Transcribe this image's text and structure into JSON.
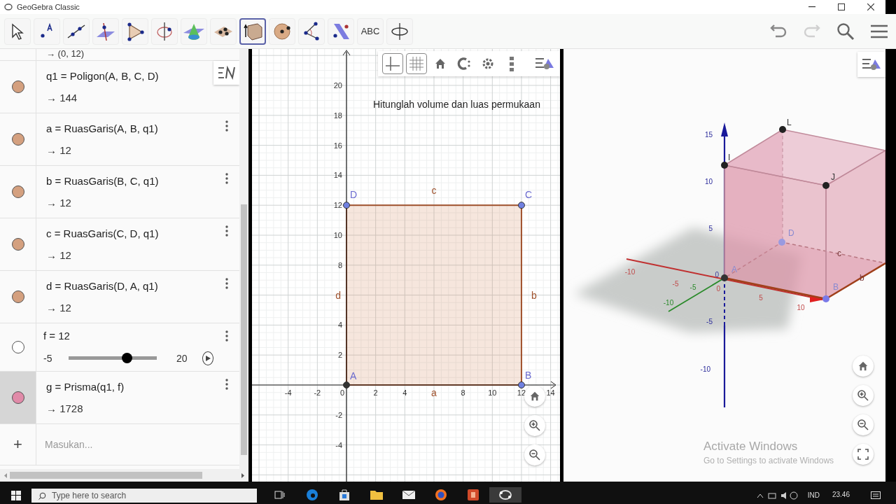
{
  "window": {
    "title": "GeoGebra Classic"
  },
  "toolbar": {
    "tools": [
      {
        "kind": "move",
        "selected": false
      },
      {
        "kind": "point",
        "selected": false
      },
      {
        "kind": "line",
        "selected": false
      },
      {
        "kind": "perpendicular",
        "selected": false
      },
      {
        "kind": "polygon",
        "selected": false
      },
      {
        "kind": "rotate-line",
        "selected": false
      },
      {
        "kind": "cone",
        "selected": false
      },
      {
        "kind": "plane",
        "selected": false
      },
      {
        "kind": "prism",
        "selected": true
      },
      {
        "kind": "sphere",
        "selected": false
      },
      {
        "kind": "angle",
        "selected": false
      },
      {
        "kind": "reflect",
        "selected": false
      },
      {
        "kind": "text",
        "label": "ABC",
        "selected": false
      },
      {
        "kind": "rotate-view",
        "selected": false
      }
    ],
    "actions": [
      {
        "kind": "undo",
        "disabled": false
      },
      {
        "kind": "redo",
        "disabled": true
      },
      {
        "kind": "search"
      },
      {
        "kind": "menu"
      }
    ]
  },
  "algebra": {
    "rows": [
      {
        "kind": "partial",
        "value": "→ (0, 12)"
      },
      {
        "kind": "expression",
        "definition": "q1 = Poligon(A, B, C, D)",
        "value": "→ 144",
        "color": "#d4a07f",
        "menu": false,
        "selected": false
      },
      {
        "kind": "expression",
        "definition": "a = RuasGaris(A, B, q1)",
        "value": "→ 12",
        "color": "#d4a07f",
        "menu": true,
        "selected": false
      },
      {
        "kind": "expression",
        "definition": "b = RuasGaris(B, C, q1)",
        "value": "→ 12",
        "color": "#d4a07f",
        "menu": true,
        "selected": false
      },
      {
        "kind": "expression",
        "definition": "c = RuasGaris(C, D, q1)",
        "value": "→ 12",
        "color": "#d4a07f",
        "menu": true,
        "selected": false
      },
      {
        "kind": "expression",
        "definition": "d = RuasGaris(D, A, q1)",
        "value": "→ 12",
        "color": "#d4a07f",
        "menu": true,
        "selected": false
      },
      {
        "kind": "slider",
        "definition": "f = 12",
        "min": "-5",
        "max": "20",
        "level": 0.66,
        "color": "#ffffff",
        "menu": true,
        "selected": false
      },
      {
        "kind": "expression",
        "definition": "g = Prisma(q1, f)",
        "value": "→ 1728",
        "color": "#e08aa8",
        "menu": true,
        "selected": true
      }
    ],
    "input": {
      "icon": "+",
      "placeholder": "Masukan..."
    }
  },
  "graphics2d": {
    "text": "Hitunglah volume dan luas permukaan",
    "style_bar": [
      {
        "kind": "axes",
        "selected": true
      },
      {
        "kind": "grid",
        "selected": true
      },
      {
        "kind": "home",
        "selected": false
      },
      {
        "kind": "label",
        "selected": false
      },
      {
        "kind": "settings",
        "selected": false
      },
      {
        "kind": "more",
        "selected": false
      },
      {
        "kind": "style",
        "selected": false
      }
    ],
    "x_ticks": [
      "-4",
      "-2",
      "0",
      "2",
      "4",
      "8",
      "10",
      "12",
      "14"
    ],
    "y_ticks": [
      "20",
      "18",
      "16",
      "14",
      "12",
      "10",
      "8",
      "4",
      "2",
      "-2",
      "-4"
    ],
    "points": [
      {
        "label": "D"
      },
      {
        "label": "C"
      },
      {
        "label": "A"
      },
      {
        "label": "B"
      }
    ],
    "segments": [
      {
        "label": "c"
      },
      {
        "label": "d"
      },
      {
        "label": "b"
      },
      {
        "label": "a"
      }
    ],
    "zoom_buttons": [
      {
        "kind": "home"
      },
      {
        "kind": "zoom-in"
      },
      {
        "kind": "zoom-out"
      }
    ]
  },
  "graphics3d": {
    "z_ticks": [
      "15",
      "10",
      "5",
      "-5",
      "-10"
    ],
    "x_ticks": [
      "-10",
      "-5",
      "5",
      "10"
    ],
    "y_ticks": [
      "-5",
      "-10"
    ],
    "origin_labels": [
      "0",
      "0"
    ],
    "points": [
      {
        "label": "L"
      },
      {
        "label": "I"
      },
      {
        "label": "J"
      },
      {
        "label": "A"
      },
      {
        "label": "D"
      },
      {
        "label": "B"
      }
    ],
    "edge_labels": [
      "c",
      "b"
    ],
    "zoom_buttons": [
      {
        "kind": "home"
      },
      {
        "kind": "zoom-in"
      },
      {
        "kind": "zoom-out"
      },
      {
        "kind": "fullscreen"
      }
    ],
    "notice": {
      "title": "Activate Windows",
      "subtitle": "Go to Settings to activate Windows"
    }
  },
  "taskbar": {
    "search_placeholder": "Type here to search",
    "apps": [
      {
        "kind": "taskview",
        "active": false
      },
      {
        "kind": "edge",
        "active": false
      },
      {
        "kind": "store",
        "active": false
      },
      {
        "kind": "folder",
        "active": false
      },
      {
        "kind": "mail",
        "active": false
      },
      {
        "kind": "firefox",
        "active": false
      },
      {
        "kind": "powerpoint",
        "active": false
      },
      {
        "kind": "geogebra",
        "active": true
      }
    ],
    "language": "IND",
    "time": "23.46"
  }
}
